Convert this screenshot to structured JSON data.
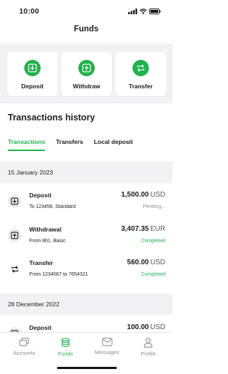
{
  "status_bar": {
    "time": "10:00"
  },
  "header": {
    "title": "Funds"
  },
  "actions": [
    {
      "label": "Deposit",
      "icon": "deposit-icon"
    },
    {
      "label": "Withdraw",
      "icon": "withdraw-icon"
    },
    {
      "label": "Transfer",
      "icon": "transfer-icon"
    }
  ],
  "history": {
    "title": "Transactions history",
    "tabs": [
      {
        "label": "Transactions",
        "active": true
      },
      {
        "label": "Transfers",
        "active": false
      },
      {
        "label": "Local deposit",
        "active": false
      }
    ],
    "groups": [
      {
        "date": "15 January 2023",
        "items": [
          {
            "icon": "deposit-icon",
            "name": "Deposit",
            "detail": "To 123456, Standard",
            "amount": "1,500.00",
            "currency": "USD",
            "status": "Pending..."
          },
          {
            "icon": "withdraw-icon",
            "name": "Withdrawal",
            "detail": "From 861, Basic",
            "amount": "3,407.35",
            "currency": "EUR",
            "status": "Completed"
          },
          {
            "icon": "transfer-icon",
            "name": "Transfer",
            "detail": "From 1234567 to 7654321",
            "amount": "560.00",
            "currency": "USD",
            "status": "Completed"
          }
        ]
      },
      {
        "date": "28 December 2022",
        "items": [
          {
            "icon": "deposit-icon",
            "name": "Deposit",
            "detail": "",
            "amount": "100.00",
            "currency": "USD",
            "status": ""
          }
        ]
      }
    ]
  },
  "tab_bar": [
    {
      "label": "Accounts",
      "icon": "accounts-icon",
      "active": false
    },
    {
      "label": "Funds",
      "icon": "funds-icon",
      "active": true
    },
    {
      "label": "Messages",
      "icon": "messages-icon",
      "active": false
    },
    {
      "label": "Profile",
      "icon": "profile-icon",
      "active": false
    }
  ],
  "colors": {
    "accent": "#21b14f",
    "pending": "#8e8e93",
    "section_bg": "#f2f2f4"
  }
}
